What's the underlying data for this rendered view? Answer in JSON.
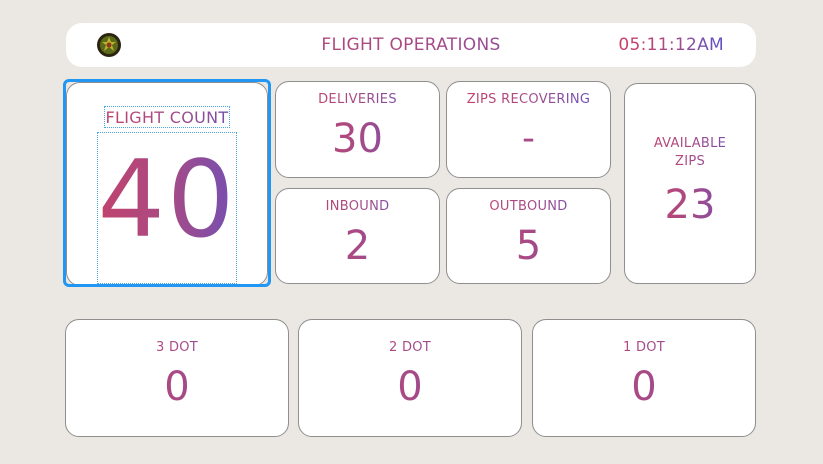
{
  "header": {
    "logo_icon": "emblem-logo-icon",
    "title": "FLIGHT OPERATIONS",
    "time": "05:11:12AM"
  },
  "flight_count": {
    "label": "FLIGHT COUNT",
    "value": "40"
  },
  "deliveries": {
    "label": "DELIVERIES",
    "value": "30"
  },
  "zips_recovering": {
    "label": "ZIPS RECOVERING",
    "value": "-"
  },
  "available_zips": {
    "label_line1": "AVAILABLE",
    "label_line2": "ZIPS",
    "value": "23"
  },
  "inbound": {
    "label": "INBOUND",
    "value": "2"
  },
  "outbound": {
    "label": "OUTBOUND",
    "value": "5"
  },
  "dots": [
    {
      "label": "3 DOT",
      "value": "0"
    },
    {
      "label": "2 DOT",
      "value": "0"
    },
    {
      "label": "1 DOT",
      "value": "0"
    }
  ],
  "colors": {
    "gradient_start": "#cc3f62",
    "gradient_end": "#5a52c8",
    "selection": "#2196f3",
    "background": "#ebe8e3"
  }
}
